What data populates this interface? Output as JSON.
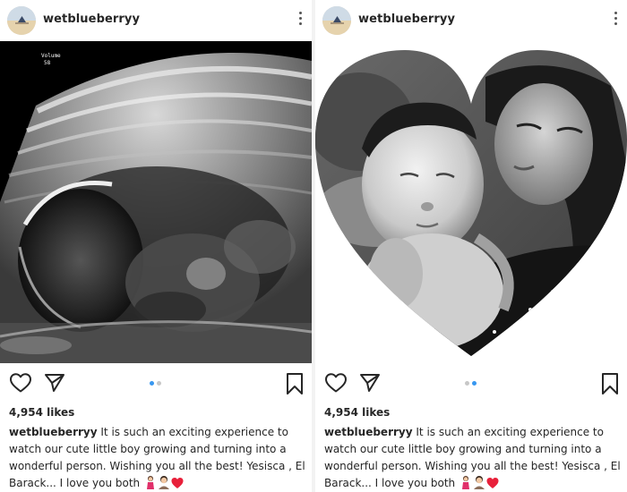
{
  "posts": [
    {
      "username": "wetblueberryy",
      "likes": "4,954 likes",
      "caption_user": "wetblueberryy",
      "caption_text": "It is such an exciting experience to watch our cute little boy growing and turning into a wonderful person. Wishing you all the best! Yesisca , El Barack... I love you both",
      "carousel": {
        "total": 2,
        "active": 1
      },
      "media": {
        "overlay_text": [
          "Volume",
          "58"
        ]
      }
    },
    {
      "username": "wetblueberryy",
      "likes": "4,954 likes",
      "caption_user": "wetblueberryy",
      "caption_text": "It is such an exciting experience to watch our cute little boy growing and turning into a wonderful person. Wishing you all the best! Yesisca , El Barack... I love you both",
      "carousel": {
        "total": 2,
        "active": 2
      }
    }
  ],
  "icons": {
    "like": "heart-outline-icon",
    "share": "paper-plane-icon",
    "save": "bookmark-icon",
    "more": "more-vertical-icon",
    "caption_emojis": [
      "woman-emoji",
      "man-emoji",
      "red-heart-emoji"
    ]
  },
  "colors": {
    "carousel_active": "#3897f0",
    "carousel_inactive": "#c7c7c7",
    "text": "#262626"
  }
}
